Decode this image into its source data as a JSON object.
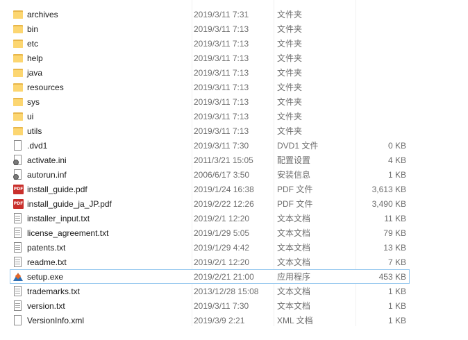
{
  "files": [
    {
      "name": "archives",
      "date": "2019/3/11 7:31",
      "type": "文件夹",
      "size": "",
      "icon": "folder-icon",
      "selected": false
    },
    {
      "name": "bin",
      "date": "2019/3/11 7:13",
      "type": "文件夹",
      "size": "",
      "icon": "folder-icon",
      "selected": false
    },
    {
      "name": "etc",
      "date": "2019/3/11 7:13",
      "type": "文件夹",
      "size": "",
      "icon": "folder-icon",
      "selected": false
    },
    {
      "name": "help",
      "date": "2019/3/11 7:13",
      "type": "文件夹",
      "size": "",
      "icon": "folder-icon",
      "selected": false
    },
    {
      "name": "java",
      "date": "2019/3/11 7:13",
      "type": "文件夹",
      "size": "",
      "icon": "folder-icon",
      "selected": false
    },
    {
      "name": "resources",
      "date": "2019/3/11 7:13",
      "type": "文件夹",
      "size": "",
      "icon": "folder-icon",
      "selected": false
    },
    {
      "name": "sys",
      "date": "2019/3/11 7:13",
      "type": "文件夹",
      "size": "",
      "icon": "folder-icon",
      "selected": false
    },
    {
      "name": "ui",
      "date": "2019/3/11 7:13",
      "type": "文件夹",
      "size": "",
      "icon": "folder-icon",
      "selected": false
    },
    {
      "name": "utils",
      "date": "2019/3/11 7:13",
      "type": "文件夹",
      "size": "",
      "icon": "folder-icon",
      "selected": false
    },
    {
      "name": ".dvd1",
      "date": "2019/3/11 7:30",
      "type": "DVD1 文件",
      "size": "0 KB",
      "icon": "blank-file-icon",
      "selected": false
    },
    {
      "name": "activate.ini",
      "date": "2011/3/21 15:05",
      "type": "配置设置",
      "size": "4 KB",
      "icon": "settings-file-icon",
      "selected": false
    },
    {
      "name": "autorun.inf",
      "date": "2006/6/17 3:50",
      "type": "安装信息",
      "size": "1 KB",
      "icon": "settings-file-icon",
      "selected": false
    },
    {
      "name": "install_guide.pdf",
      "date": "2019/1/24 16:38",
      "type": "PDF 文件",
      "size": "3,613 KB",
      "icon": "pdf-icon",
      "selected": false
    },
    {
      "name": "install_guide_ja_JP.pdf",
      "date": "2019/2/22 12:26",
      "type": "PDF 文件",
      "size": "3,490 KB",
      "icon": "pdf-icon",
      "selected": false
    },
    {
      "name": "installer_input.txt",
      "date": "2019/2/1 12:20",
      "type": "文本文档",
      "size": "11 KB",
      "icon": "text-file-icon",
      "selected": false
    },
    {
      "name": "license_agreement.txt",
      "date": "2019/1/29 5:05",
      "type": "文本文档",
      "size": "79 KB",
      "icon": "text-file-icon",
      "selected": false
    },
    {
      "name": "patents.txt",
      "date": "2019/1/29 4:42",
      "type": "文本文档",
      "size": "13 KB",
      "icon": "text-file-icon",
      "selected": false
    },
    {
      "name": "readme.txt",
      "date": "2019/2/1 12:20",
      "type": "文本文档",
      "size": "7 KB",
      "icon": "text-file-icon",
      "selected": false
    },
    {
      "name": "setup.exe",
      "date": "2019/2/21 21:00",
      "type": "应用程序",
      "size": "453 KB",
      "icon": "matlab-exe-icon",
      "selected": true
    },
    {
      "name": "trademarks.txt",
      "date": "2013/12/28 15:08",
      "type": "文本文档",
      "size": "1 KB",
      "icon": "text-file-icon",
      "selected": false
    },
    {
      "name": "version.txt",
      "date": "2019/3/11 7:30",
      "type": "文本文档",
      "size": "1 KB",
      "icon": "text-file-icon",
      "selected": false
    },
    {
      "name": "VersionInfo.xml",
      "date": "2019/3/9 2:21",
      "type": "XML 文档",
      "size": "1 KB",
      "icon": "blank-file-icon",
      "selected": false
    }
  ],
  "colors": {
    "selection_border": "#99c9ef",
    "folder": "#fcd671",
    "pdf": "#c9302c"
  }
}
